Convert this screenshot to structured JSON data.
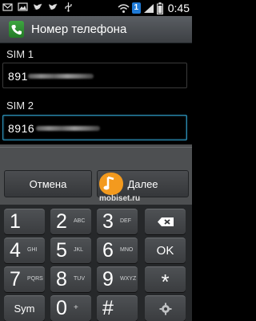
{
  "status_bar": {
    "time": "0:45",
    "sim_badge": "1",
    "left_icons": [
      "mail-icon",
      "image-icon",
      "twitter-bird-icon",
      "twitter-bird-icon",
      "usb-icon"
    ],
    "right_icons": [
      "wifi-icon",
      "sim-badge",
      "signal-icon",
      "battery-icon"
    ]
  },
  "title_bar": {
    "title": "Номер телефона",
    "icon": "phone-icon"
  },
  "sims": [
    {
      "label": "SIM 1",
      "value": "891"
    },
    {
      "label": "SIM 2",
      "value": "8916"
    }
  ],
  "buttons": {
    "cancel": "Отмена",
    "next": "Далее"
  },
  "watermark": "mobiset.ru",
  "keypad": {
    "rows": [
      [
        {
          "main": "1",
          "sub": ""
        },
        {
          "main": "2",
          "sub": "ABC"
        },
        {
          "main": "3",
          "sub": "DEF"
        },
        {
          "main": "",
          "sub": "",
          "icon": "backspace-icon"
        }
      ],
      [
        {
          "main": "4",
          "sub": "GHI"
        },
        {
          "main": "5",
          "sub": "JKL"
        },
        {
          "main": "6",
          "sub": "MNO"
        },
        {
          "main": "OK",
          "sub": ""
        }
      ],
      [
        {
          "main": "7",
          "sub": "PQRS"
        },
        {
          "main": "8",
          "sub": "TUV"
        },
        {
          "main": "9",
          "sub": "WXYZ"
        },
        {
          "main": "*",
          "sub": ""
        }
      ],
      [
        {
          "main": "Sym",
          "sub": ""
        },
        {
          "main": "0",
          "sub": "+"
        },
        {
          "main": "#",
          "sub": ""
        },
        {
          "main": "",
          "sub": "",
          "icon": "gear-icon"
        }
      ]
    ]
  },
  "colors": {
    "accent": "#2c91b8",
    "title_bar": "#4a4d51",
    "keypad_bg": "#26282a"
  }
}
